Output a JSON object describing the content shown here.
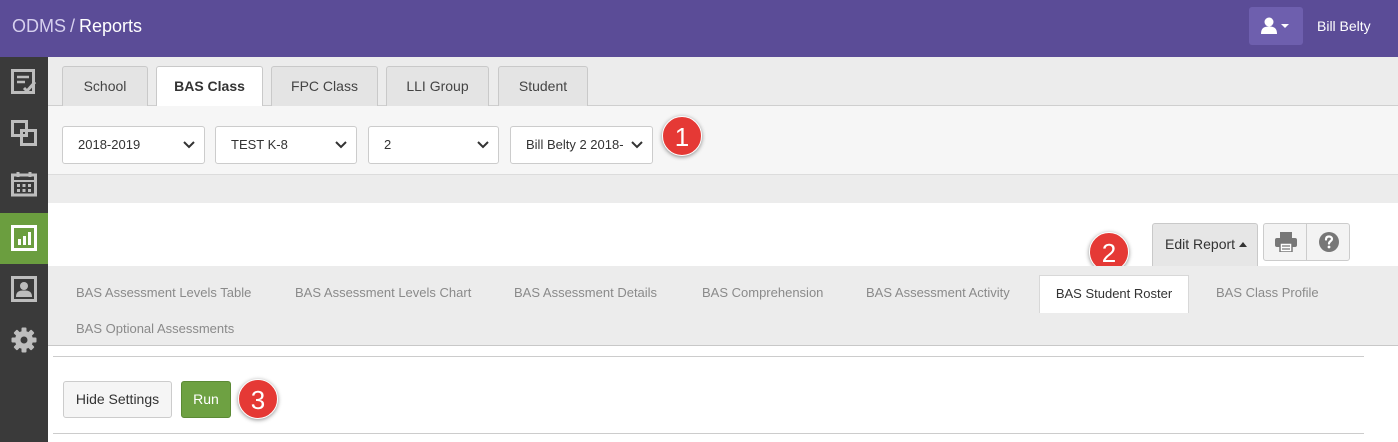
{
  "header": {
    "app_name": "ODMS",
    "separator": "/",
    "page_title": "Reports",
    "user_name": "Bill Belty",
    "user_icon": "user-icon"
  },
  "sidebar": {
    "items": [
      {
        "icon": "assessment-checklist-icon",
        "active": false
      },
      {
        "icon": "groups-icon",
        "active": false
      },
      {
        "icon": "calendar-icon",
        "active": false
      },
      {
        "icon": "reports-chart-icon",
        "active": true
      },
      {
        "icon": "student-profile-icon",
        "active": false
      },
      {
        "icon": "gear-icon",
        "active": false
      }
    ]
  },
  "class_tabs": {
    "school": "School",
    "bas_class": "BAS Class",
    "fpc_class": "FPC Class",
    "lli_group": "LLI Group",
    "student": "Student",
    "active": "BAS Class"
  },
  "filters": {
    "year": "2018-2019",
    "school": "TEST K-8",
    "grade": "2",
    "class": "Bill Belty 2 2018-"
  },
  "callouts": {
    "one": "1",
    "two": "2",
    "three": "3"
  },
  "report_toolbar": {
    "edit_report": "Edit Report",
    "print_icon": "print-icon",
    "help_icon": "help-icon"
  },
  "report_tabs": {
    "levels_table": "BAS Assessment Levels Table",
    "levels_chart": "BAS Assessment Levels Chart",
    "details": "BAS Assessment Details",
    "comprehension": "BAS Comprehension",
    "activity": "BAS Assessment Activity",
    "roster": "BAS Student Roster",
    "class_profile": "BAS Class Profile",
    "optional": "BAS Optional Assessments",
    "active": "BAS Student Roster"
  },
  "actions": {
    "hide_settings": "Hide Settings",
    "run": "Run"
  },
  "colors": {
    "header_bg": "#5b4c97",
    "sidebar_bg": "#3a3a3a",
    "sidebar_active": "#6b9e3f",
    "run_button": "#6ea142",
    "callout": "#e53935"
  }
}
